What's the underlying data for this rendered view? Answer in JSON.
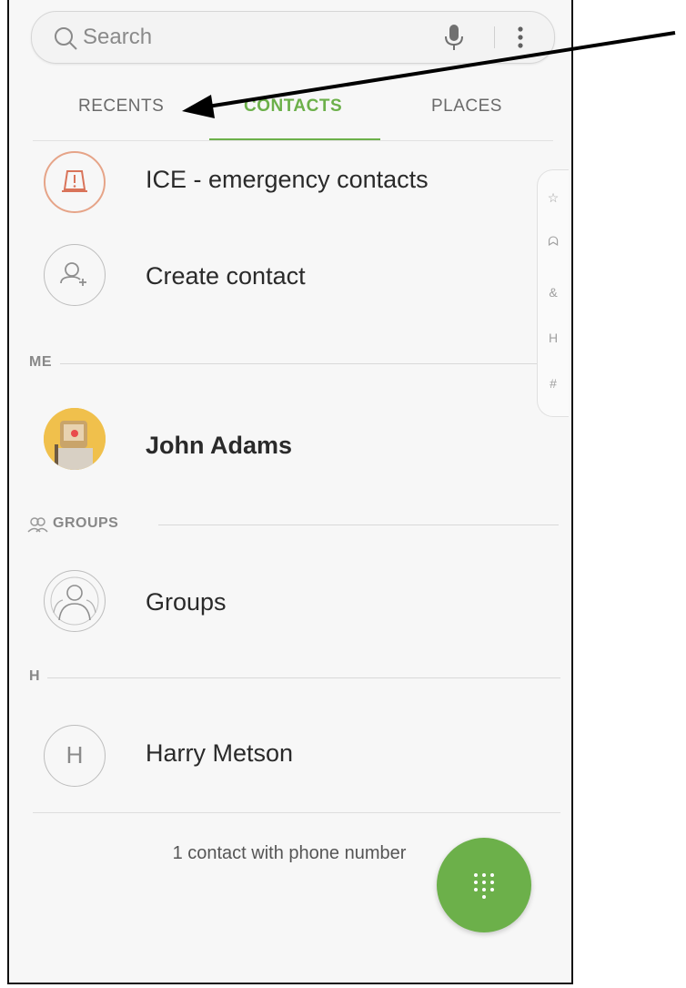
{
  "search": {
    "placeholder": "Search"
  },
  "tabs": [
    {
      "label": "RECENTS",
      "active": false
    },
    {
      "label": "CONTACTS",
      "active": true
    },
    {
      "label": "PLACES",
      "active": false
    }
  ],
  "top_items": [
    {
      "label": "ICE - emergency contacts",
      "icon": "warning-icon"
    },
    {
      "label": "Create contact",
      "icon": "add-contact-icon"
    }
  ],
  "sections": {
    "me": {
      "header": "ME",
      "contact": {
        "name": "John Adams",
        "icon": "profile-avatar"
      }
    },
    "groups": {
      "header": "GROUPS",
      "item": {
        "label": "Groups",
        "icon": "groups-icon"
      }
    },
    "h": {
      "header": "H",
      "contact": {
        "name": "Harry Metson",
        "initial": "H"
      }
    }
  },
  "index_bar": [
    "☆",
    "ᗣ",
    "&",
    "H",
    "#"
  ],
  "footer": {
    "count_text": "1 contact with phone number"
  },
  "colors": {
    "accent": "#6cb04a",
    "warning": "#e08060"
  }
}
